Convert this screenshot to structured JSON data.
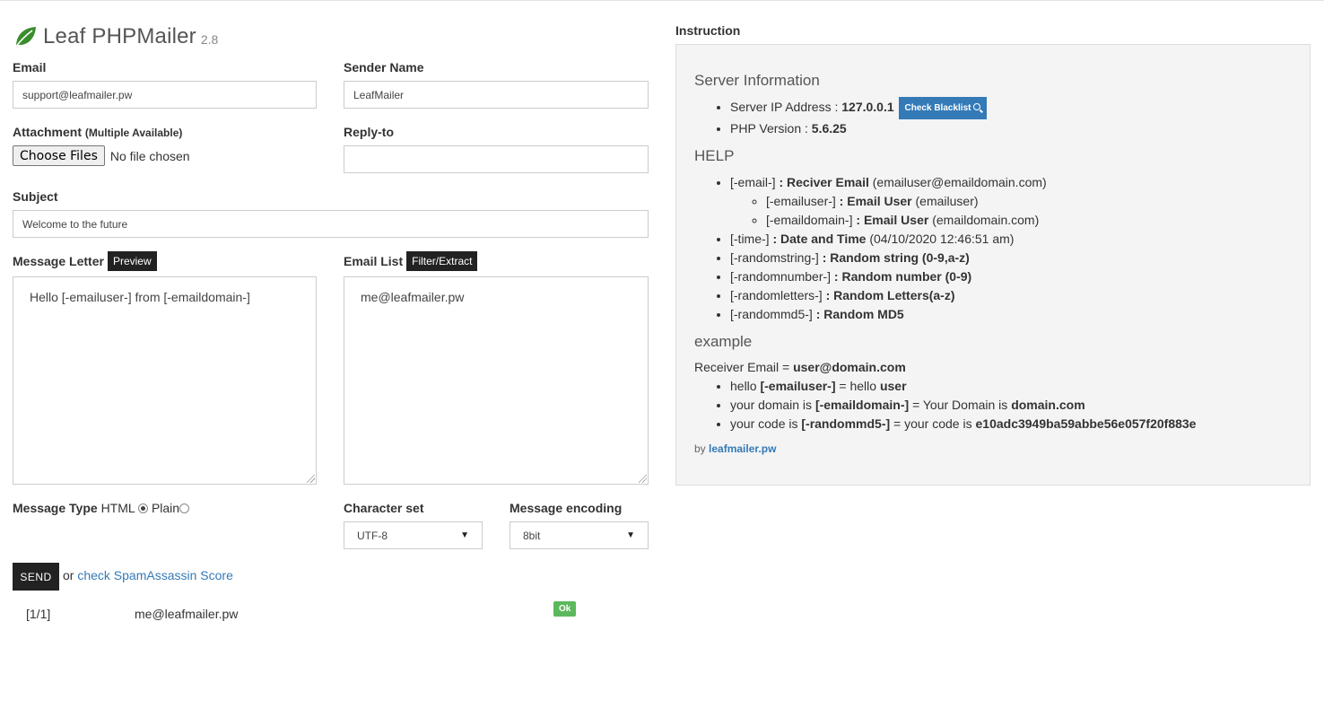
{
  "brand": {
    "name": "Leaf PHPMailer",
    "version": "2.8"
  },
  "form": {
    "email": {
      "label": "Email",
      "value": "support@leafmailer.pw"
    },
    "sender_name": {
      "label": "Sender Name",
      "value": "LeafMailer"
    },
    "attachment": {
      "label": "Attachment",
      "hint": "(Multiple Available)",
      "button": "Choose Files",
      "status": "No file chosen"
    },
    "reply_to": {
      "label": "Reply-to",
      "value": ""
    },
    "subject": {
      "label": "Subject",
      "value": "Welcome to the future"
    },
    "message": {
      "label": "Message Letter",
      "preview_button": "Preview",
      "value": "Hello [-emailuser-] from [-emaildomain-]"
    },
    "email_list": {
      "label": "Email List",
      "filter_button": "Filter/Extract",
      "value": "me@leafmailer.pw"
    },
    "message_type": {
      "label": "Message Type",
      "options": [
        "HTML",
        "Plain"
      ],
      "selected": "HTML"
    },
    "charset": {
      "label": "Character set",
      "value": "UTF-8"
    },
    "encoding": {
      "label": "Message encoding",
      "value": "8bit"
    },
    "send_button": "SEND",
    "or_text": "or",
    "spam_link": "check SpamAssassin Score"
  },
  "results": [
    {
      "index": "[1/1]",
      "email": "me@leafmailer.pw",
      "status": "Ok"
    }
  ],
  "instruction": {
    "title": "Instruction",
    "server_info": {
      "heading": "Server Information",
      "ip_label": "Server IP Address :",
      "ip_value": "127.0.0.1",
      "blacklist_button": "Check Blacklist",
      "php_label": "PHP Version :",
      "php_value": "5.6.25"
    },
    "help": {
      "heading": "HELP",
      "email_tag": "[-email-]",
      "email_sep": " : ",
      "email_desc": "Reciver Email",
      "email_example": "(emailuser@emaildomain.com)",
      "emailuser_tag": "[-emailuser-]",
      "emailuser_desc": "Email User",
      "emailuser_example": "(emailuser)",
      "emaildomain_tag": "[-emaildomain-]",
      "emaildomain_desc": "Email User",
      "emaildomain_example": "(emaildomain.com)",
      "time_tag": "[-time-]",
      "time_desc": "Date and Time",
      "time_example": "(04/10/2020 12:46:51 am)",
      "randomstring_tag": "[-randomstring-]",
      "randomstring_desc": "Random string (0-9,a-z)",
      "randomnumber_tag": "[-randomnumber-]",
      "randomnumber_desc": "Random number (0-9)",
      "randomletters_tag": "[-randomletters-]",
      "randomletters_desc": "Random Letters(a-z)",
      "randommd5_tag": "[-randommd5-]",
      "randommd5_desc": "Random MD5"
    },
    "example": {
      "heading": "example",
      "receiver_label": "Receiver Email =",
      "receiver_value": "user@domain.com",
      "ex1_a": "hello",
      "ex1_tag": "[-emailuser-]",
      "ex1_b": "= hello",
      "ex1_val": "user",
      "ex2_a": "your domain is",
      "ex2_tag": "[-emaildomain-]",
      "ex2_b": "= Your Domain is",
      "ex2_val": "domain.com",
      "ex3_a": "your code is",
      "ex3_tag": "[-randommd5-]",
      "ex3_b": "= your code is",
      "ex3_val": "e10adc3949ba59abbe56e057f20f883e"
    },
    "credit_by": "by",
    "credit_link": "leafmailer.pw"
  },
  "colors": {
    "accent": "#337ab7",
    "dark": "#222222",
    "ok": "#5cb85c",
    "leaf": "#3a8d2c"
  }
}
